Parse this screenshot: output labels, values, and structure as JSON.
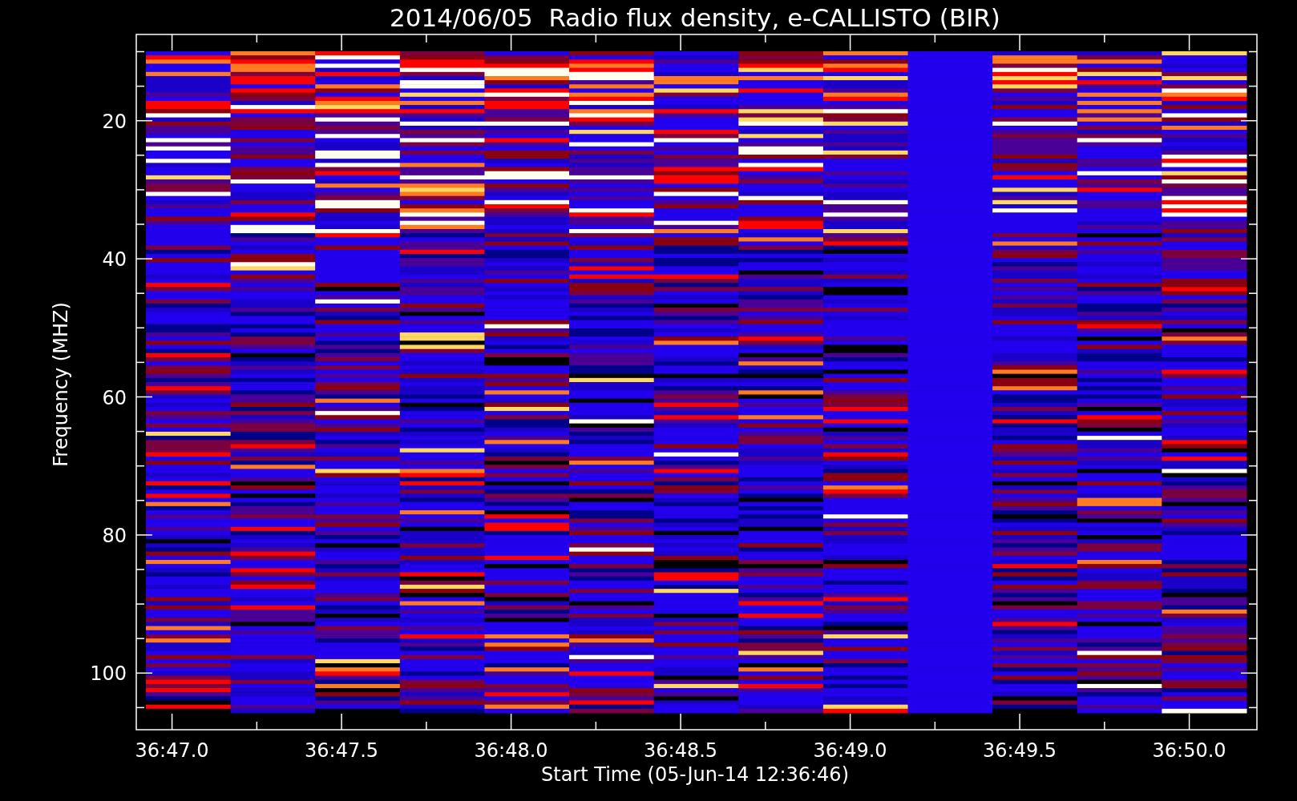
{
  "title": "2014/06/05  Radio flux density, e-CALLISTO (BIR)",
  "plot": {
    "ylabel": "Frequency (MHZ)",
    "xlabel": "Start Time (05-Jun-14 12:36:46)",
    "yticks": [
      "20",
      "40",
      "60",
      "80",
      "100"
    ],
    "xticks": [
      "36:47.0",
      "36:47.5",
      "36:48.0",
      "36:48.5",
      "36:49.0",
      "36:49.5",
      "36:50.0"
    ]
  }
}
